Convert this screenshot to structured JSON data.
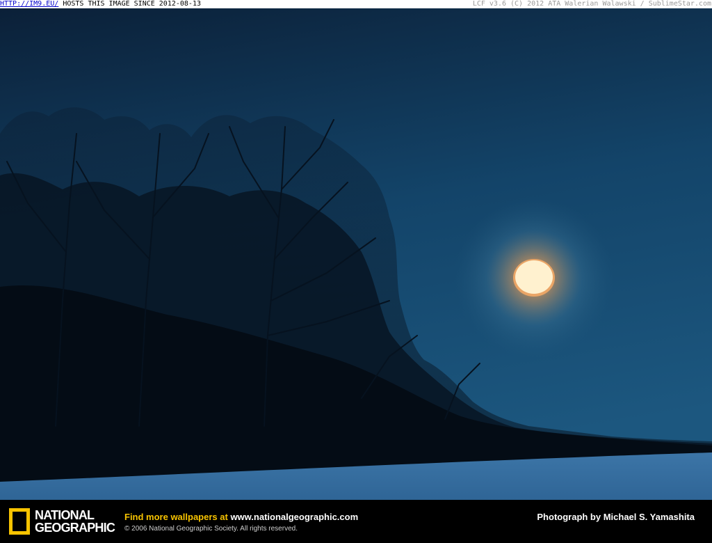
{
  "header": {
    "link_text": "HTTP://IM9.EU/",
    "host_text": " HOSTS THIS IMAGE SINCE 2012-08-13",
    "right_text": "LCF v3.6 (C) 2012 ATA Walerian Walawski / SublimeStar.com"
  },
  "footer": {
    "brand_line1": "NATIONAL",
    "brand_line2": "GEOGRAPHIC",
    "promo_prefix": "Find more wallpapers at ",
    "promo_url": "www.nationalgeographic.com",
    "copyright": "© 2006 National Geographic Society. All rights reserved.",
    "credit": "Photograph by Michael S. Yamashita"
  },
  "colors": {
    "sky_top": "#0b2038",
    "sky_mid": "#134469",
    "moon": "#fff1cf",
    "snow": "#3e77a8",
    "accent_yellow": "#f7c300"
  }
}
